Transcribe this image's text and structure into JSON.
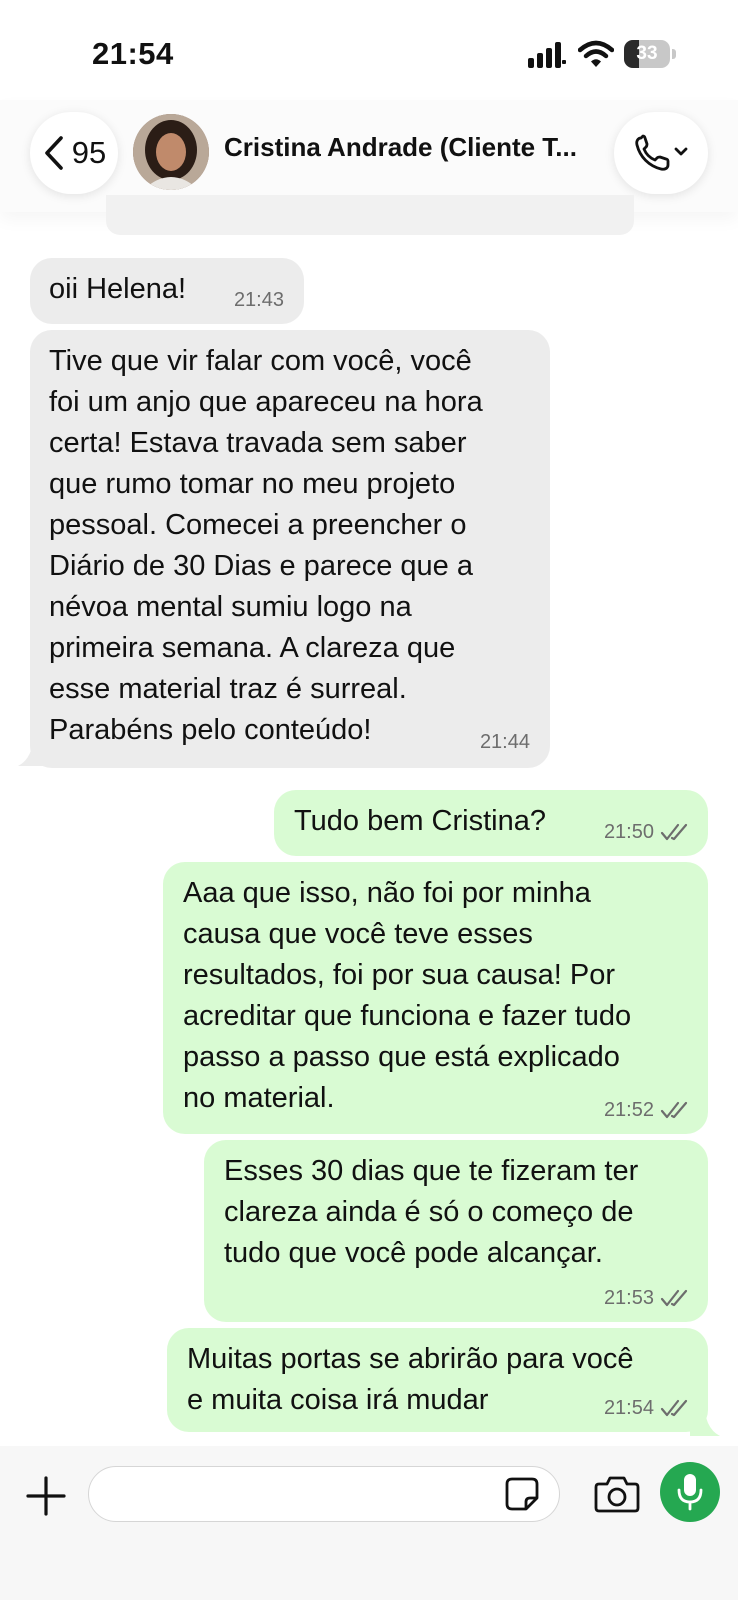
{
  "status_bar": {
    "time": "21:54",
    "battery": "33",
    "battery_level": 0.33
  },
  "header": {
    "back_count": "95",
    "contact_name": "Cristina Andrade (Cliente T..."
  },
  "messages": [
    {
      "direction": "in",
      "text": "oii Helena!",
      "time": "21:43"
    },
    {
      "direction": "in",
      "text": "Tive que vir falar com você, você\nfoi um anjo que apareceu na hora\ncerta! Estava travada sem saber\nque rumo tomar no meu projeto\npessoal. Comecei a preencher o\nDiário de 30 Dias e parece que a\nnévoa mental sumiu logo na\nprimeira semana. A clareza que\nesse material traz é surreal.\nParabéns pelo conteúdo!",
      "time": "21:44"
    },
    {
      "direction": "out",
      "text": "Tudo bem Cristina?",
      "time": "21:50",
      "status": "read"
    },
    {
      "direction": "out",
      "text": "Aaa que isso, não foi por minha\ncausa que você teve esses\nresultados, foi por sua causa! Por\nacreditar que funciona e fazer tudo\npasso a passo que está explicado\nno material.",
      "time": "21:52",
      "status": "read"
    },
    {
      "direction": "out",
      "text": "Esses 30 dias que te fizeram ter\nclareza ainda é só o começo de\ntudo que você pode alcançar.",
      "time": "21:53",
      "status": "read"
    },
    {
      "direction": "out",
      "text": "Muitas portas se abrirão para você\ne muita coisa irá mudar",
      "time": "21:54",
      "status": "read"
    }
  ],
  "input": {
    "value": "",
    "placeholder": ""
  },
  "colors": {
    "incoming_bubble": "#ececec",
    "outgoing_bubble": "#d9fbd3",
    "mic_button": "#25a851",
    "read_check": "#6d6d6d"
  },
  "icons": [
    "back-chevron-icon",
    "phone-icon",
    "chevron-down-icon",
    "plus-icon",
    "sticker-icon",
    "camera-icon",
    "microphone-icon",
    "double-check-icon"
  ]
}
